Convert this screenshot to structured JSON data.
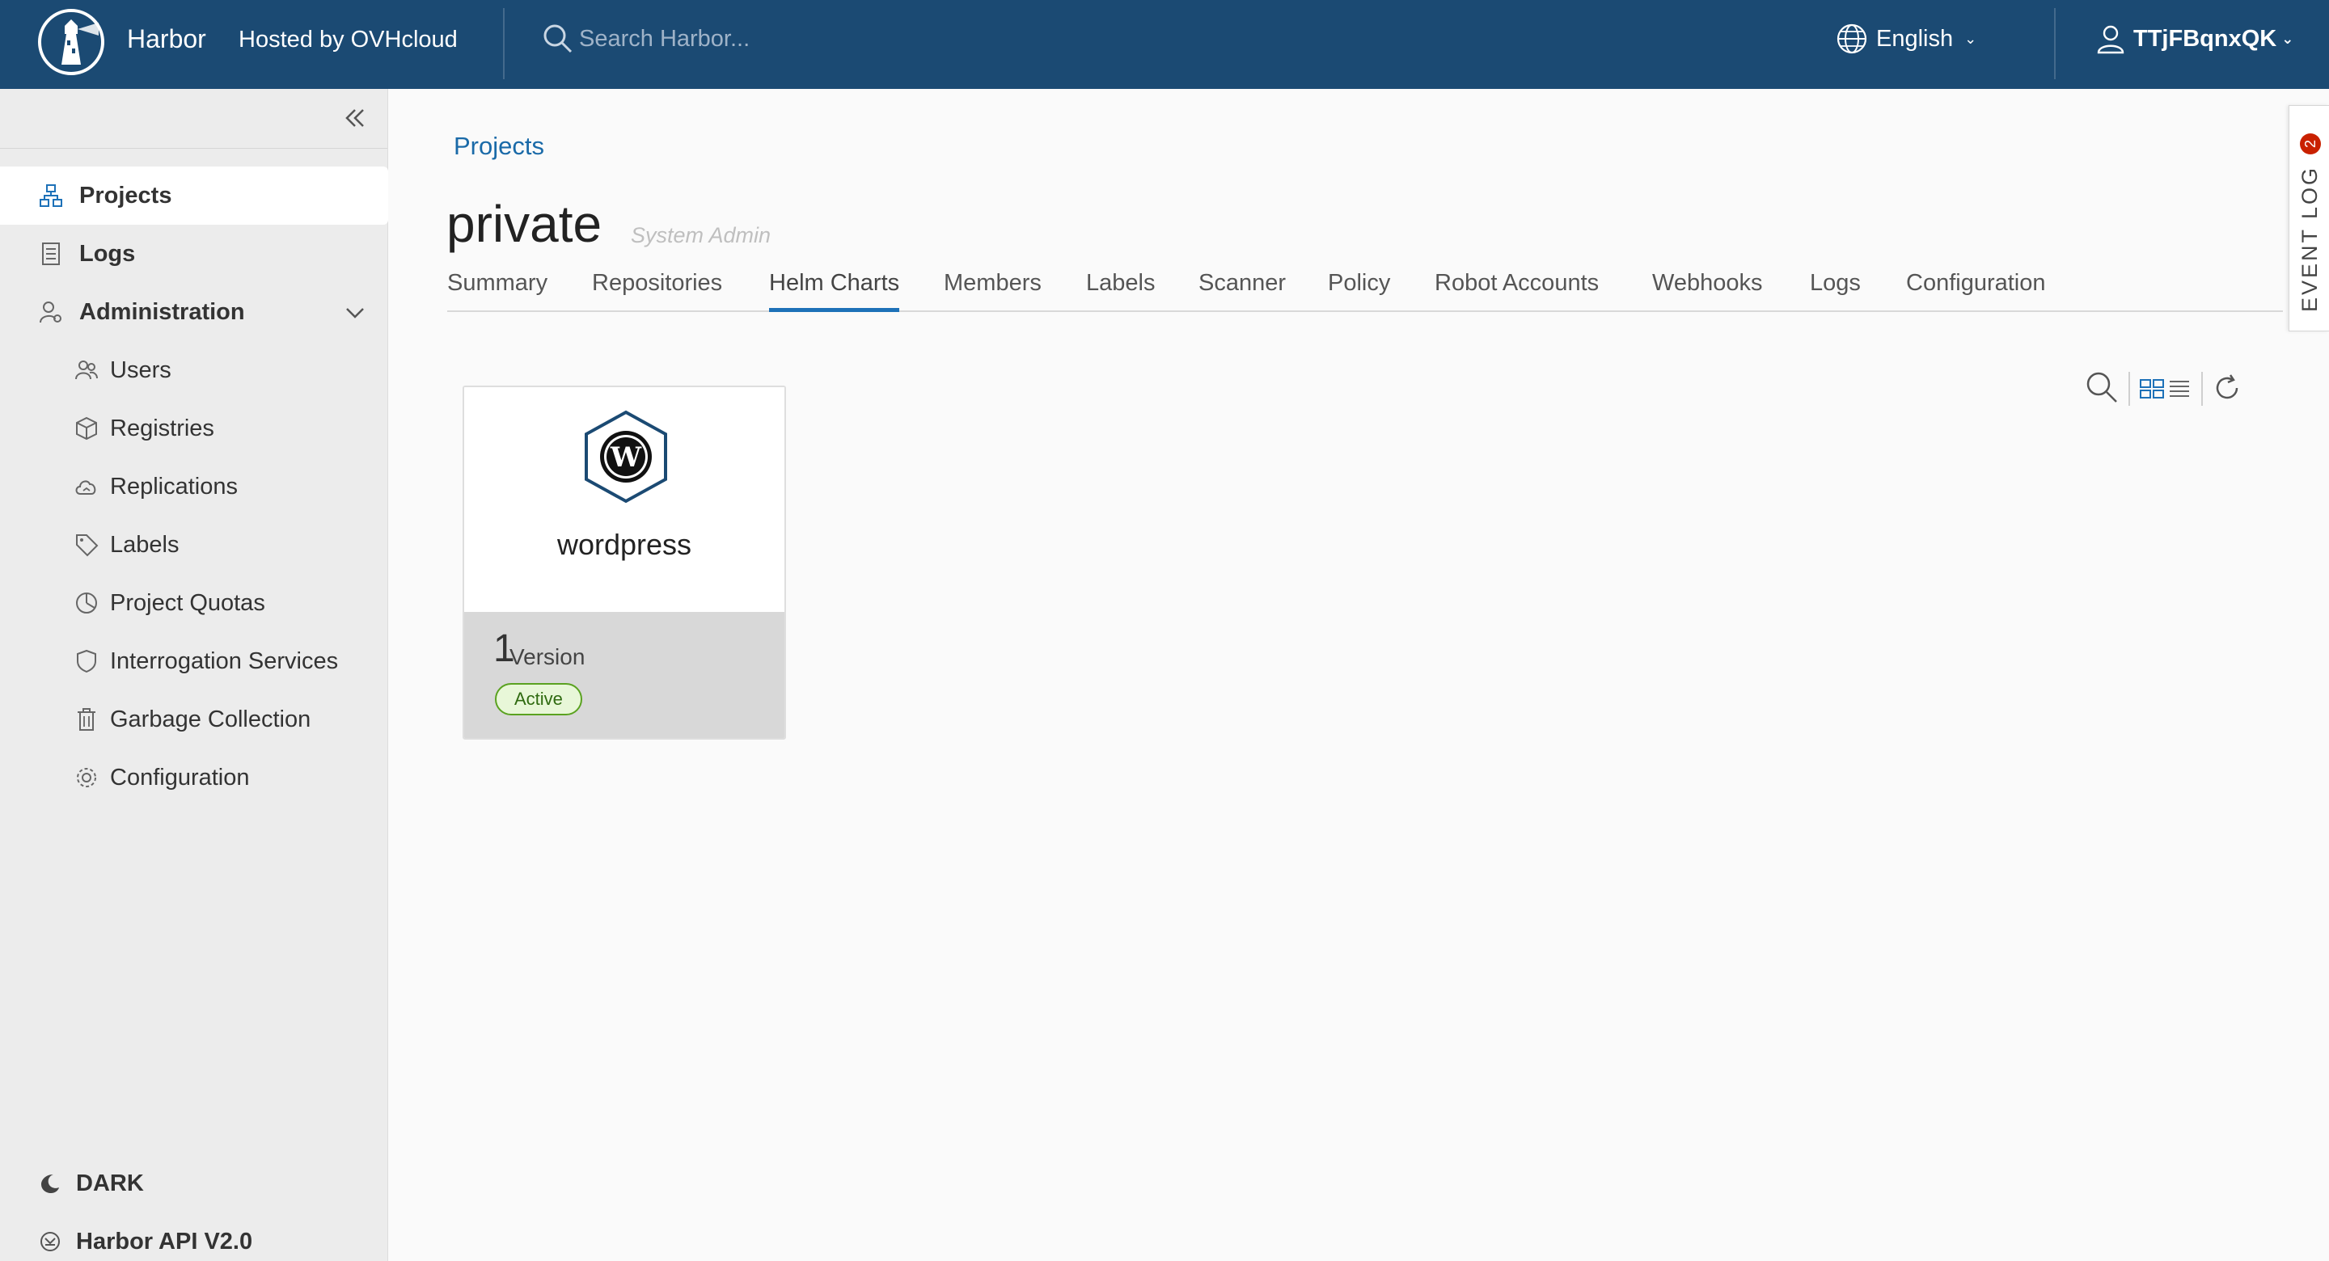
{
  "header": {
    "brand": "Harbor",
    "hosted_by": "Hosted by OVHcloud",
    "search_placeholder": "Search Harbor...",
    "language": "English",
    "username": "TTjFBqnxQK"
  },
  "sidebar": {
    "items": [
      {
        "label": "Projects",
        "icon": "projects-icon"
      },
      {
        "label": "Logs",
        "icon": "logs-icon"
      },
      {
        "label": "Administration",
        "icon": "administration-icon"
      },
      {
        "label": "Users",
        "icon": "users-icon"
      },
      {
        "label": "Registries",
        "icon": "registries-icon"
      },
      {
        "label": "Replications",
        "icon": "replications-icon"
      },
      {
        "label": "Labels",
        "icon": "tag-icon"
      },
      {
        "label": "Project Quotas",
        "icon": "quota-icon"
      },
      {
        "label": "Interrogation Services",
        "icon": "shield-icon"
      },
      {
        "label": "Garbage Collection",
        "icon": "trash-icon"
      },
      {
        "label": "Configuration",
        "icon": "gear-icon"
      }
    ],
    "dark_label": "DARK",
    "api_label": "Harbor API V2.0"
  },
  "main": {
    "breadcrumb": "Projects",
    "title": "private",
    "role": "System Admin",
    "tabs": [
      {
        "label": "Summary"
      },
      {
        "label": "Repositories"
      },
      {
        "label": "Helm Charts",
        "active": true
      },
      {
        "label": "Members"
      },
      {
        "label": "Labels"
      },
      {
        "label": "Scanner"
      },
      {
        "label": "Policy"
      },
      {
        "label": "Robot Accounts"
      },
      {
        "label": "Webhooks"
      },
      {
        "label": "Logs"
      },
      {
        "label": "Configuration"
      }
    ]
  },
  "charts": [
    {
      "name": "wordpress",
      "version_count": "1",
      "version_label": "Version",
      "status": "Active",
      "icon": "wordpress-icon"
    }
  ],
  "event_log": {
    "label": "EVENT LOG",
    "count": "2"
  },
  "colors": {
    "header_bg": "#1b4a73",
    "accent": "#1d71b8",
    "active_badge": "#5aa220",
    "event_badge": "#c92100"
  }
}
